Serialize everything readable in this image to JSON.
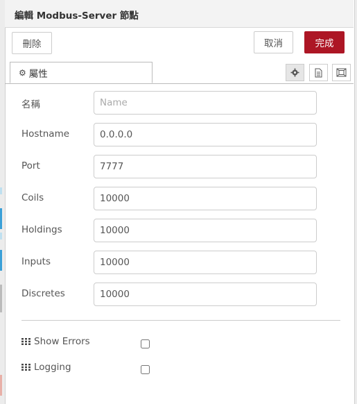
{
  "header": {
    "title": "編輯 Modbus-Server 節點"
  },
  "buttons": {
    "delete": "刪除",
    "cancel": "取消",
    "done": "完成"
  },
  "tab": {
    "label": "屬性",
    "icon": "gear-icon"
  },
  "toolbar_icons": [
    "gear-icon",
    "file-icon",
    "frame-icon"
  ],
  "fields": {
    "name": {
      "label": "名稱",
      "value": "",
      "placeholder": "Name"
    },
    "hostname": {
      "label": "Hostname",
      "value": "0.0.0.0"
    },
    "port": {
      "label": "Port",
      "value": "7777"
    },
    "coils": {
      "label": "Coils",
      "value": "10000"
    },
    "holdings": {
      "label": "Holdings",
      "value": "10000"
    },
    "inputs": {
      "label": "Inputs",
      "value": "10000"
    },
    "discretes": {
      "label": "Discretes",
      "value": "10000"
    }
  },
  "checkboxes": {
    "show_errors": {
      "label": "Show Errors",
      "checked": false,
      "icon": "grid-icon"
    },
    "logging": {
      "label": "Logging",
      "checked": false,
      "icon": "grid-icon"
    }
  },
  "colors": {
    "primary": "#ad1625",
    "border": "#cccccc",
    "header_bg": "#f3f3f3"
  }
}
